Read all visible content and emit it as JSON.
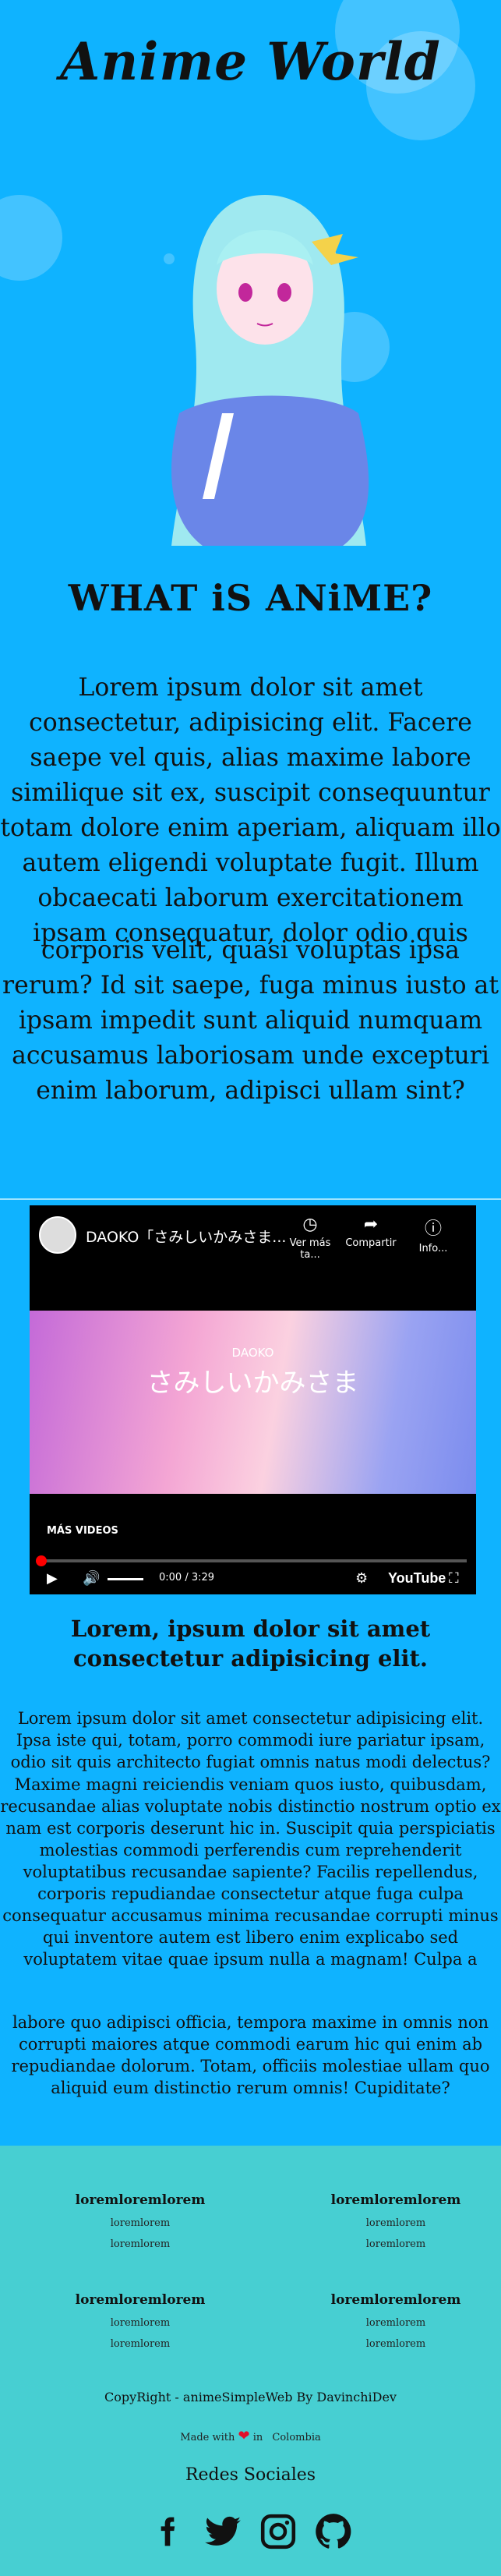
{
  "header": {
    "title": "Anime World"
  },
  "about": {
    "heading": "WHAT iS ANiME?",
    "para1": "Lorem ipsum dolor sit amet consectetur, adipisicing elit. Facere saepe vel quis, alias maxime labore similique sit ex, suscipit consequuntur totam dolore enim aperiam, aliquam illo autem eligendi voluptate fugit. Illum obcaecati laborum exercitationem ipsam consequatur, dolor odio quis",
    "para2": "corporis velit, quasi voluptas ipsa rerum? Id sit saepe, fuga minus iusto at ipsam impedit sunt aliquid numquam accusamus laboriosam unde excepturi enim laborum, adipisci ullam sint?"
  },
  "video": {
    "channel_title": "DAOKO「さみしいかみさま...",
    "watch_later": "Ver más ta...",
    "share": "Compartir",
    "info": "Info...",
    "thumb_brand": "DAOKO",
    "thumb_title": "さみしいかみさま",
    "more_videos": "MÁS VIDEOS",
    "time": "0:00 / 3:29",
    "youtube": "YouTube",
    "progress": 0.005
  },
  "section2": {
    "heading": "Lorem, ipsum dolor sit amet consectetur adipisicing elit.",
    "para1": "Lorem ipsum dolor sit amet consectetur adipisicing elit. Ipsa iste qui, totam, porro commodi iure pariatur ipsam, odio sit quis architecto fugiat omnis natus modi delectus?",
    "para2": "Maxime magni reiciendis veniam quos iusto, quibusdam, recusandae alias voluptate nobis distinctio nostrum optio ex nam est corporis deserunt hic in. Suscipit quia perspiciatis molestias commodi perferendis cum reprehenderit voluptatibus recusandae sapiente? Facilis repellendus, corporis repudiandae consectetur atque fuga culpa consequatur accusamus minima recusandae corrupti minus qui inventore autem est libero enim explicabo sed voluptatem vitae quae ipsum nulla a magnam! Culpa a",
    "para3": "labore quo adipisci officia, tempora maxime in omnis non corrupti maiores atque commodi earum hic qui enim ab repudiandae dolorum. Totam, officiis molestiae ullam quo aliquid eum distinctio rerum omnis! Cupiditate?"
  },
  "footer": {
    "columns": [
      {
        "heading": "loremloremlorem",
        "links": [
          "loremlorem",
          "loremlorem"
        ]
      },
      {
        "heading": "loremloremlorem",
        "links": [
          "loremlorem",
          "loremlorem"
        ]
      },
      {
        "heading": "loremloremlorem",
        "links": [
          "loremlorem",
          "loremlorem"
        ]
      },
      {
        "heading": "loremloremlorem",
        "links": [
          "loremlorem",
          "loremlorem"
        ]
      }
    ],
    "copyright": "CopyRight - animeSimpleWeb By DavinchiDev",
    "made_with": "Made with",
    "made_in": "in",
    "country": "Colombia",
    "social_heading": "Redes Sociales",
    "social_icons": [
      "facebook-icon",
      "twitter-icon",
      "instagram-icon",
      "github-icon"
    ]
  },
  "colors": {
    "page_bg": "#0fb3ff",
    "footer_bg": "#47cfd2",
    "heart": "#e0102a",
    "yt_red": "#ff0000"
  }
}
